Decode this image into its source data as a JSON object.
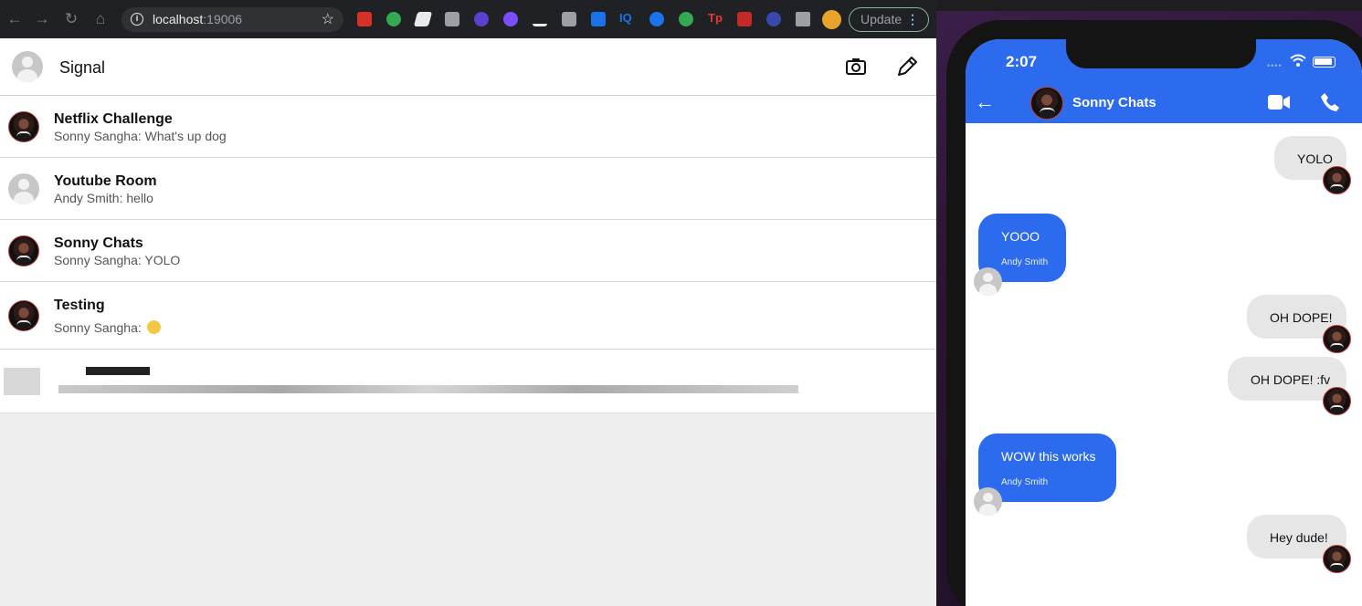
{
  "browser": {
    "url_host": "localhost",
    "url_port": ":19006",
    "update_label": "Update",
    "extensions": [
      "ext-red",
      "ext-green",
      "ext-white",
      "ext-h",
      "ext-purple-star",
      "ext-purple-circle",
      "ext-pen",
      "ext-code",
      "ext-blue-b",
      "IQ",
      "ext-blue-wave",
      "ext-green-circle",
      "Tp",
      "ext-chart",
      "ext-blue-dot",
      "puzzle-icon"
    ]
  },
  "app": {
    "title": "Signal",
    "chats": [
      {
        "name": "Netflix Challenge",
        "preview": "Sonny Sangha: What's up dog",
        "avatar": "photo"
      },
      {
        "name": "Youtube Room",
        "preview": "Andy Smith: hello",
        "avatar": "default"
      },
      {
        "name": "Sonny Chats",
        "preview": "Sonny Sangha: YOLO",
        "avatar": "photo"
      },
      {
        "name": "Testing",
        "preview": "Sonny Sangha: ",
        "avatar": "photo",
        "emoji": "sleepy-face"
      }
    ]
  },
  "phone": {
    "time": "2:07",
    "chat_title": "Sonny Chats",
    "messages": [
      {
        "side": "me",
        "text": "YOLO"
      },
      {
        "side": "them",
        "text": "YOOO",
        "sender": "Andy Smith"
      },
      {
        "side": "me",
        "text": "OH DOPE!"
      },
      {
        "side": "me",
        "text": "OH DOPE! :fv"
      },
      {
        "side": "them",
        "text": "WOW this works",
        "sender": "Andy Smith"
      },
      {
        "side": "me",
        "text": "Hey dude!"
      }
    ]
  },
  "colors": {
    "signal_blue": "#2c6bed",
    "my_bubble": "#e6e6e6"
  }
}
